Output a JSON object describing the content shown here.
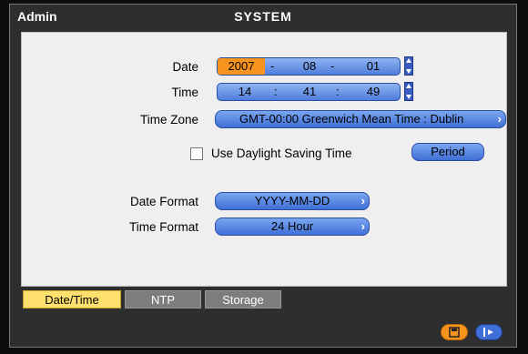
{
  "window": {
    "user": "Admin",
    "title": "SYSTEM"
  },
  "form": {
    "date_label": "Date",
    "date": {
      "year": "2007",
      "month": "08",
      "day": "01",
      "sep": "-"
    },
    "time_label": "Time",
    "time": {
      "hour": "14",
      "minute": "41",
      "second": "49",
      "sep": ":"
    },
    "timezone_label": "Time Zone",
    "timezone": "GMT-00:00 Greenwich Mean Time : Dublin",
    "dst_label": "Use Daylight Saving Time",
    "dst_checked": false,
    "period_label": "Period",
    "date_format_label": "Date Format",
    "date_format": "YYYY-MM-DD",
    "time_format_label": "Time Format",
    "time_format": "24 Hour"
  },
  "tabs": [
    {
      "label": "Date/Time",
      "active": true
    },
    {
      "label": "NTP",
      "active": false
    },
    {
      "label": "Storage",
      "active": false
    }
  ],
  "icons": {
    "save": "save-icon",
    "exit": "exit-icon"
  },
  "colors": {
    "accent_orange": "#f7941d",
    "field_blue": "#4f7fdb",
    "tab_active": "#fde06e"
  }
}
